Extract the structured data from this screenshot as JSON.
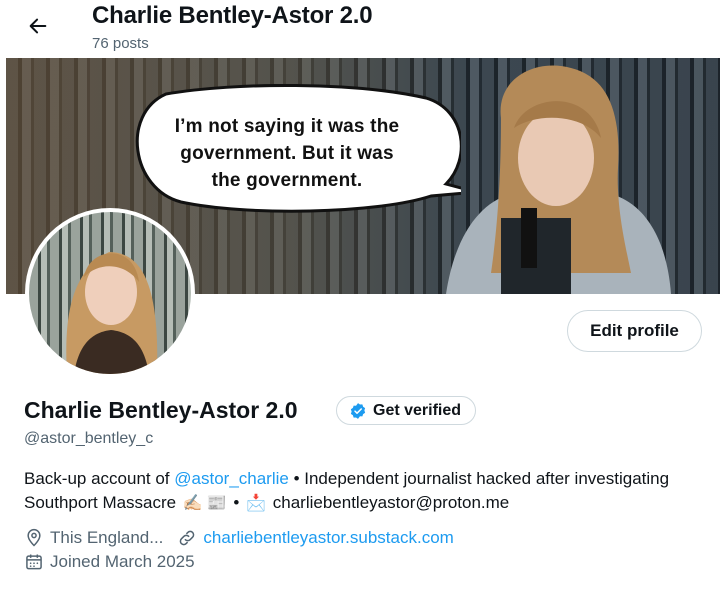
{
  "header": {
    "title": "Charlie Bentley-Astor 2.0",
    "posts": "76 posts"
  },
  "banner": {
    "speech_line1": "I’m not saying it was the",
    "speech_line2": "government. But it was",
    "speech_line3": "the government."
  },
  "profile": {
    "edit_label": "Edit profile",
    "name": "Charlie Bentley-Astor 2.0",
    "get_verified_label": "Get verified",
    "handle": "@astor_bentley_c",
    "bio_part1": "Back-up account of ",
    "bio_mention": "@astor_charlie",
    "bio_part2": " •  Independent journalist hacked after investigating Southport Massacre ",
    "bio_part3": " •  ",
    "bio_email": "charliebentleyastor@proton.me",
    "location": "This England...",
    "website": "charliebentleyastor.substack.com",
    "joined": "Joined March 2025"
  },
  "colors": {
    "accent": "#1d9bf0",
    "muted": "#536471"
  },
  "icons": [
    "back-arrow-icon",
    "verified-badge-icon",
    "location-icon",
    "link-icon",
    "calendar-icon",
    "writing-hand-emoji",
    "newspaper-emoji",
    "envelope-emoji"
  ]
}
